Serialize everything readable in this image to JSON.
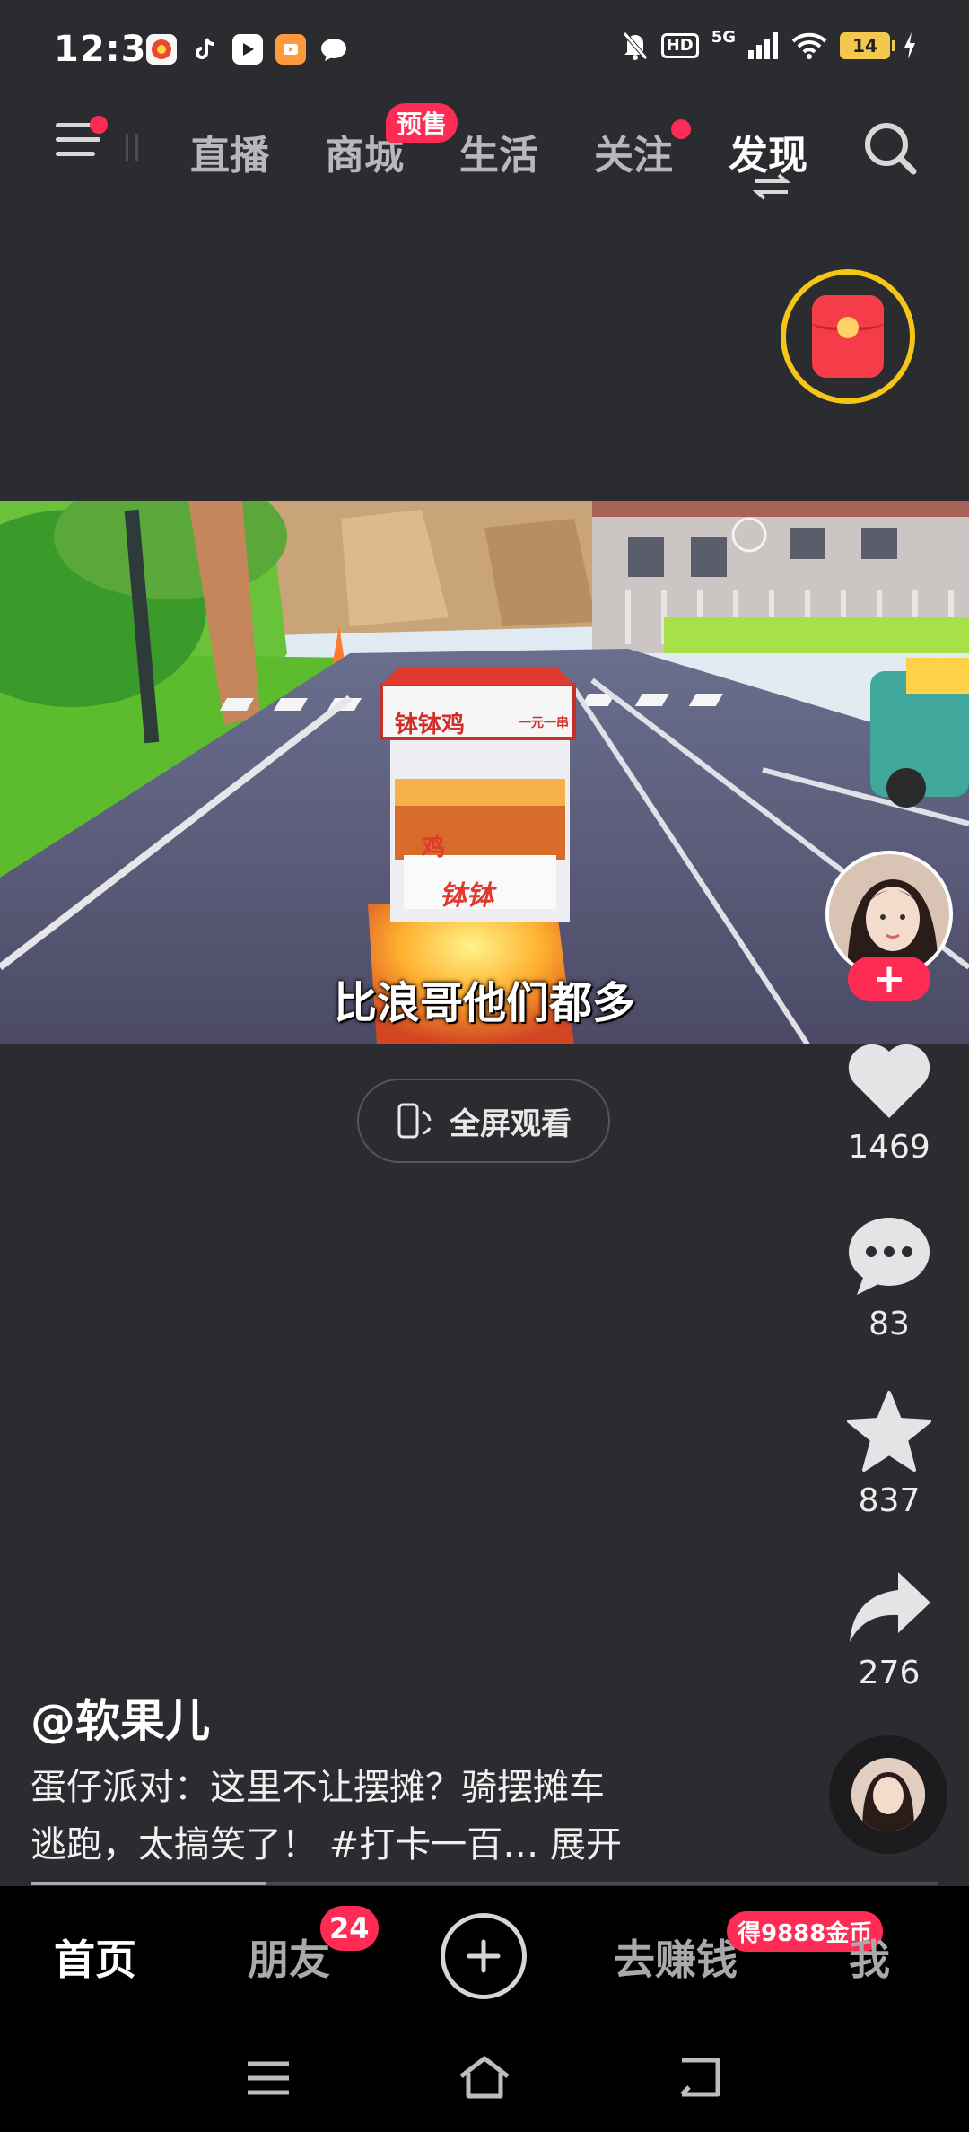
{
  "status_bar": {
    "time": "12:31",
    "hd": "HD",
    "network": "5G",
    "battery": "14"
  },
  "top_nav": {
    "tabs": [
      {
        "label": "直播"
      },
      {
        "label": "商城"
      },
      {
        "label": "生活"
      },
      {
        "label": "关注"
      },
      {
        "label": "发现"
      }
    ],
    "presale_badge": "预售"
  },
  "video": {
    "subtitle": "比浪哥他们都多",
    "stall_sign": "钵钵鸡",
    "stall_price": "一元一串",
    "fullscreen_label": "全屏观看"
  },
  "actions": {
    "likes": "1469",
    "comments": "83",
    "favorites": "837",
    "shares": "276"
  },
  "post": {
    "author": "@软果儿",
    "description_line1": "蛋仔派对：这里不让摆摊？骑摆摊车",
    "description_line2": "逃跑，太搞笑了！ #打卡一百… 展开",
    "progress": 0.26
  },
  "bottom_nav": {
    "home": "首页",
    "friends": "朋友",
    "friends_badge": "24",
    "earn": "去赚钱",
    "earn_badge": "得9888金币",
    "me": "我"
  },
  "colors": {
    "background": "#2b2c30",
    "accent": "#fe2c55",
    "red_packet_ring": "#f5c518"
  }
}
